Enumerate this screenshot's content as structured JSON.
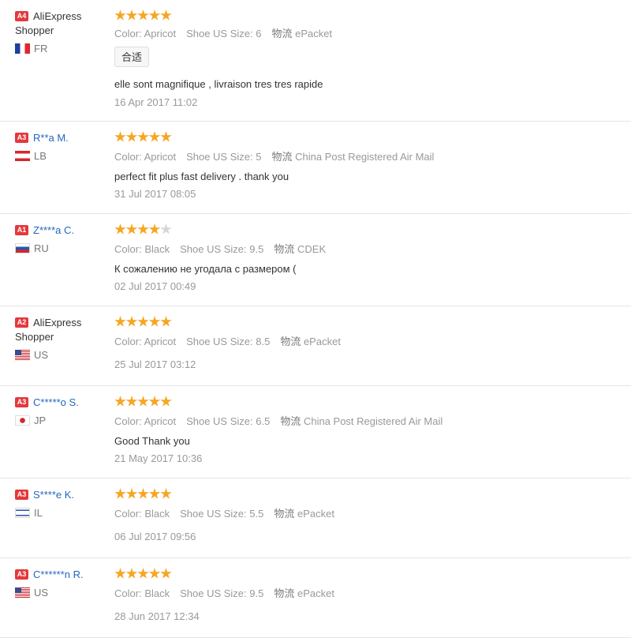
{
  "rating_max": 5,
  "colors": {
    "star": "#f5a623",
    "star_empty": "#d6d6d6",
    "link": "#2366c1",
    "badge": "#e4393c"
  },
  "labels": {
    "color": "Color:",
    "shoe_size": "Shoe US Size:",
    "logistics": "物流"
  },
  "reviews": [
    {
      "level": "A4",
      "name": "AliExpress Shopper",
      "country": "FR",
      "flag": "fr",
      "rating": 5,
      "color": "Apricot",
      "size": "6",
      "shipping": "ePacket",
      "tag": "合适",
      "comment": "elle sont magnifique , livraison tres tres rapide",
      "date": "16 Apr 2017 11:02"
    },
    {
      "level": "A3",
      "name": "R**a M.",
      "country": "LB",
      "flag": "lb",
      "rating": 5,
      "color": "Apricot",
      "size": "5",
      "shipping": "China Post Registered Air Mail",
      "comment": "perfect fit plus fast delivery . thank you",
      "date": "31 Jul 2017 08:05"
    },
    {
      "level": "A1",
      "name": "Z****a C.",
      "country": "RU",
      "flag": "ru",
      "rating": 4,
      "color": "Black",
      "size": "9.5",
      "shipping": "CDEK",
      "comment": "К сожалению не угодала с размером (",
      "date": "02 Jul 2017 00:49"
    },
    {
      "level": "A2",
      "name": "AliExpress Shopper",
      "country": "US",
      "flag": "us",
      "rating": 5,
      "color": "Apricot",
      "size": "8.5",
      "shipping": "ePacket",
      "date": "25 Jul 2017 03:12"
    },
    {
      "level": "A3",
      "name": "C*****o S.",
      "country": "JP",
      "flag": "jp",
      "rating": 5,
      "color": "Apricot",
      "size": "6.5",
      "shipping": "China Post Registered Air Mail",
      "comment": "Good Thank you",
      "date": "21 May 2017 10:36"
    },
    {
      "level": "A3",
      "name": "S****e K.",
      "country": "IL",
      "flag": "il",
      "rating": 5,
      "color": "Black",
      "size": "5.5",
      "shipping": "ePacket",
      "date": "06 Jul 2017 09:56"
    },
    {
      "level": "A3",
      "name": "C******n R.",
      "country": "US",
      "flag": "us",
      "rating": 5,
      "color": "Black",
      "size": "9.5",
      "shipping": "ePacket",
      "date": "28 Jun 2017 12:34"
    }
  ]
}
